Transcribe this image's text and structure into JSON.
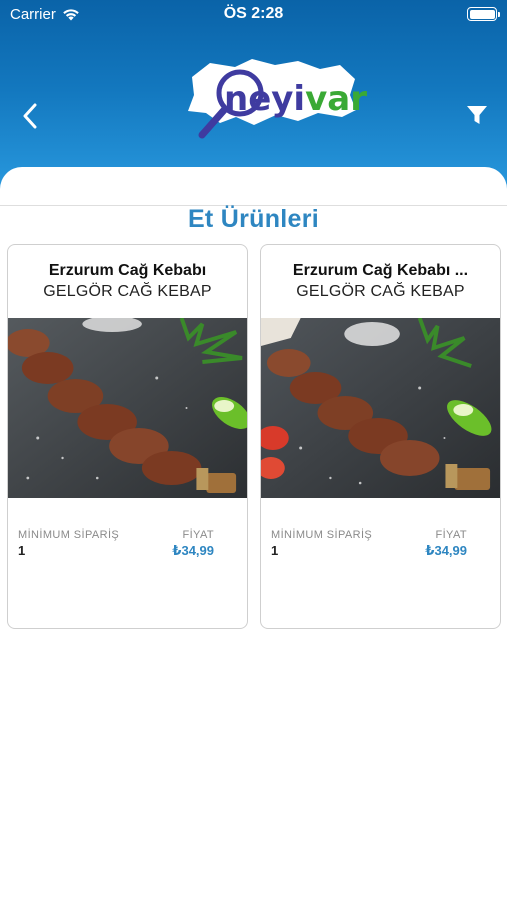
{
  "status_bar": {
    "carrier": "Carrier",
    "time": "ÖS 2:28"
  },
  "header": {
    "logo": {
      "text_primary": "neyi",
      "text_accent": "var",
      "icon": "magnifier-map-logo"
    },
    "back_icon": "chevron-left-icon",
    "filter_icon": "filter-icon"
  },
  "section": {
    "title": "Et Ürünleri"
  },
  "labels": {
    "min_order": "MİNİMUM SİPARİŞ",
    "price": "FİYAT"
  },
  "products": [
    {
      "name": "Erzurum Cağ Kebabı",
      "shop": "GELGÖR CAĞ KEBAP",
      "min_order": "1",
      "price": "₺34,99"
    },
    {
      "name": "Erzurum Cağ Kebabı ...",
      "shop": "GELGÖR CAĞ KEBAP",
      "min_order": "1",
      "price": "₺34,99"
    }
  ],
  "colors": {
    "header_top": "#0a63a8",
    "header_bottom": "#2a9be0",
    "accent": "#2e86c1"
  }
}
